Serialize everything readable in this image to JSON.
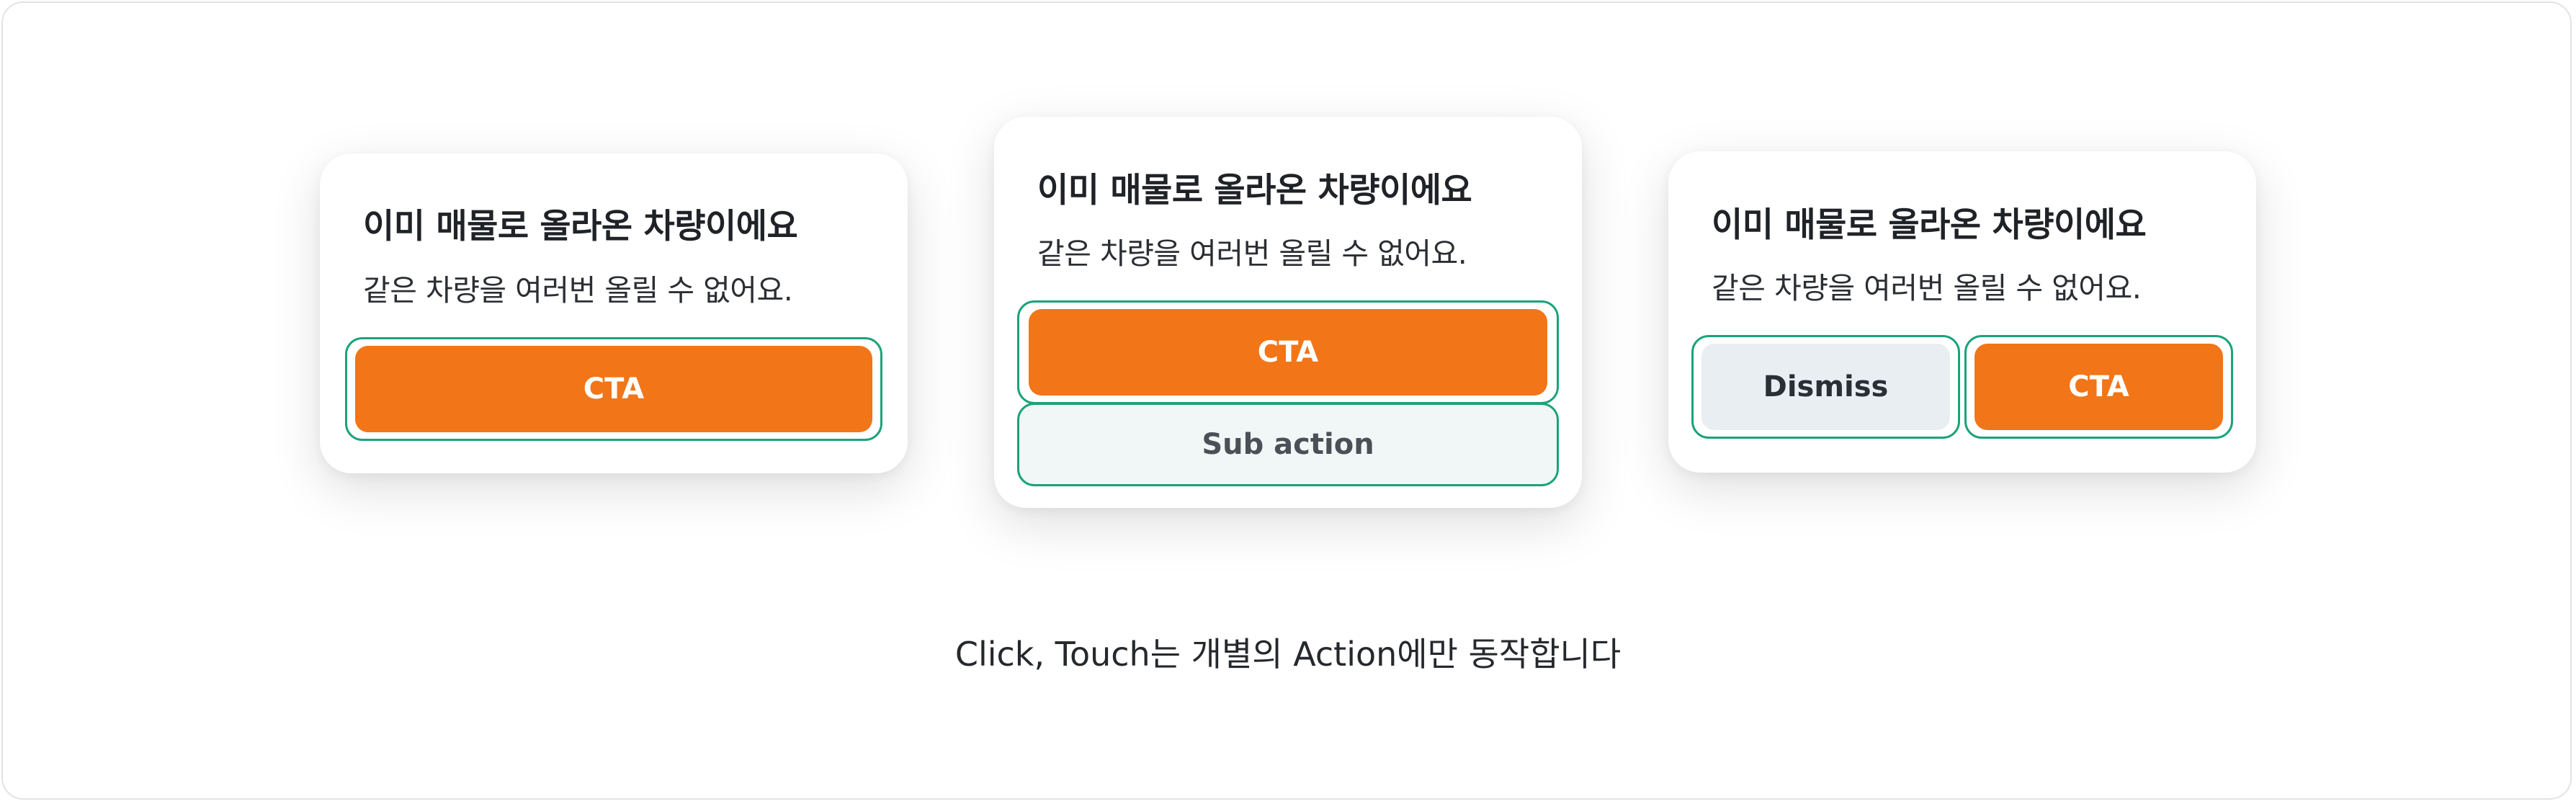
{
  "cards": [
    {
      "title": "이미 매물로 올라온 차량이에요",
      "subtitle": "같은 차량을 여러번 올릴 수 없어요.",
      "cta_label": "CTA"
    },
    {
      "title": "이미 매물로 올라온 차량이에요",
      "subtitle": "같은 차량을 여러번 올릴 수 없어요.",
      "cta_label": "CTA",
      "sub_action_label": "Sub action"
    },
    {
      "title": "이미 매물로 올라온 차량이에요",
      "subtitle": "같은 차량을 여러번 올릴 수 없어요.",
      "dismiss_label": "Dismiss",
      "cta_label": "CTA"
    }
  ],
  "caption": "Click, Touch는 개별의 Action에만 동작합니다",
  "colors": {
    "cta": "#f27518",
    "dismiss": "#e8eef1",
    "sub_action": "#f1f7f6",
    "touch_outline": "#1aa37a"
  }
}
